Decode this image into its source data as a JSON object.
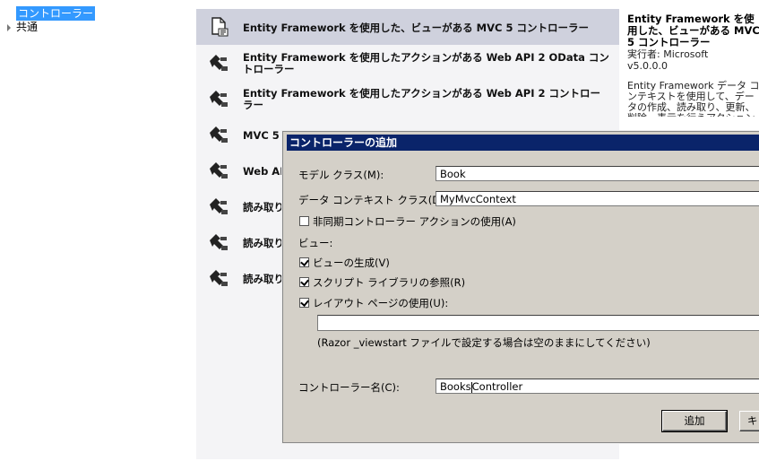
{
  "tree": {
    "selected": "コントローラー",
    "item2": "共通"
  },
  "templates": [
    {
      "label": "Entity Framework を使用した、ビューがある MVC 5 コントローラー",
      "icon": "mvc-scaffold-icon",
      "selected": true
    },
    {
      "label": "Entity Framework を使用したアクションがある Web API 2 OData コントローラー",
      "icon": "controller-icon"
    },
    {
      "label": "Entity Framework を使用したアクションがある Web API 2 コントローラー",
      "icon": "controller-icon"
    },
    {
      "label": "MVC 5",
      "icon": "controller-icon"
    },
    {
      "label": "Web AP",
      "icon": "controller-icon"
    },
    {
      "label": "読み取り",
      "icon": "controller-icon"
    },
    {
      "label": "読み取り",
      "icon": "controller-icon"
    },
    {
      "label": "読み取り",
      "icon": "controller-icon"
    }
  ],
  "description": {
    "title": "Entity Framework を使用した、ビューがある MVC 5 コントローラー",
    "author": "実行者: Microsoft",
    "version": "v5.0.0.0",
    "text": "Entity Framework データ コンテキストを使用して、データの作成、読み取り、更新、削除、表示を行うアクションと Razor ビューを持つ MVC コントローラー。"
  },
  "dialog": {
    "title": "コントローラーの追加",
    "model_label": "モデル クラス(M):",
    "model_value": "Book",
    "context_label": "データ コンテキスト クラス(D):",
    "context_value": "MyMvcContext",
    "async_label": "非同期コントローラー アクションの使用(A)",
    "async_checked": false,
    "views_label": "ビュー:",
    "gen_views_label": "ビューの生成(V)",
    "gen_views_checked": true,
    "script_ref_label": "スクリプト ライブラリの参照(R)",
    "script_ref_checked": true,
    "layout_label": "レイアウト ページの使用(U):",
    "layout_checked": true,
    "layout_value": "",
    "layout_hint": "(Razor _viewstart ファイルで設定する場合は空のままにしてください)",
    "controller_name_label": "コントローラー名(C):",
    "controller_name_before_caret": "Books",
    "controller_name_after_caret": "Controller",
    "add_button": "追加",
    "cancel_button": "キ"
  }
}
